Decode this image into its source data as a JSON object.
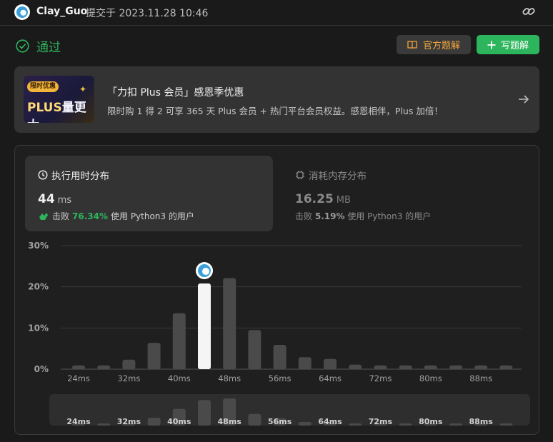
{
  "header": {
    "username": "Clay_Guo",
    "meta": "提交于 2023.11.28 10:46"
  },
  "status": {
    "label": "通过"
  },
  "actions": {
    "official_label": "官方题解",
    "write_label": "写题解"
  },
  "promo": {
    "badge": "限时优惠",
    "image_text_a": "PLUS",
    "image_text_b": "量更大",
    "title": "「力扣 Plus 会员」感恩季优惠",
    "subtitle": "限时购 1 得 2 可享 365 天 Plus 会员 + 热门平台会员权益。感恩相伴，Plus 加倍！"
  },
  "runtime": {
    "title": "执行用时分布",
    "value": "44",
    "unit": "ms",
    "beat_label": "击败",
    "beat_pct": "76.34%",
    "beat_suffix": "使用 Python3 的用户"
  },
  "memory": {
    "title": "消耗内存分布",
    "value": "16.25",
    "unit": "MB",
    "beat_label": "击败",
    "beat_pct": "5.19%",
    "beat_suffix": "使用 Python3 的用户"
  },
  "colors": {
    "accent": "#2db55d",
    "bar": "#4a4a4a",
    "highlight": "#f5f5f5",
    "official": "#f0a63a"
  },
  "chart_data": {
    "type": "bar",
    "ylim": [
      0,
      30
    ],
    "y_ticks": [
      "0%",
      "10%",
      "20%",
      "30%"
    ],
    "x_tick_labels": [
      "24ms",
      "32ms",
      "40ms",
      "48ms",
      "56ms",
      "64ms",
      "72ms",
      "80ms",
      "88ms"
    ],
    "values": [
      0.9,
      0.9,
      2.3,
      6.4,
      13.6,
      20.8,
      22.1,
      9.5,
      5.9,
      2.9,
      2.5,
      1.1,
      0.9,
      0.9,
      0.9,
      0.9,
      0.9,
      0.9
    ],
    "highlight_index": 5,
    "grid": true
  }
}
